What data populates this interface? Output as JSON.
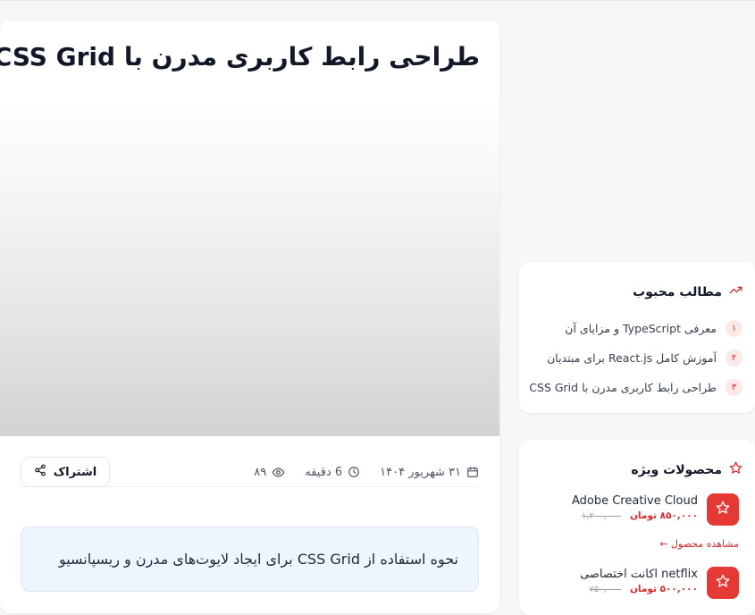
{
  "article": {
    "title": "طراحی رابط کاربری مدرن با CSS Grid",
    "date": "۳۱ شهریور ۱۴۰۴",
    "read_time": "6 دقیقه",
    "views": "۸۹",
    "share_label": "اشتراک",
    "excerpt": "نحوه استفاده از CSS Grid برای ایجاد لایوت‌های مدرن و ریسپانسیو"
  },
  "popular": {
    "title": "مطالب محبوب",
    "items": [
      {
        "num": "۱",
        "label": "معرفی TypeScript و مزایای آن"
      },
      {
        "num": "۲",
        "label": "آموزش کامل React.js برای مبتدیان"
      },
      {
        "num": "۳",
        "label": "طراحی رابط کاربری مدرن با CSS Grid"
      }
    ]
  },
  "products": {
    "title": "محصولات ویژه",
    "view_label": "مشاهده محصول ←",
    "items": [
      {
        "name": "Adobe Creative Cloud",
        "price": "۸۵۰,۰۰۰ تومان",
        "old_price": "۱,۲۰۰,۰۰۰"
      },
      {
        "name": "اکانت اختصاصی netflix",
        "price": "۵۰۰,۰۰۰ تومان",
        "old_price": "۷۵۰,۰۰۰"
      }
    ]
  },
  "colors": {
    "accent": "#dc2626",
    "product_thumb": "#e53935",
    "excerpt_bg": "#eff5ff"
  },
  "icons": {
    "calendar": "calendar-icon",
    "clock": "clock-icon",
    "eye": "eye-icon",
    "share": "share-icon",
    "trend": "trending-up-icon",
    "star": "star-icon"
  }
}
